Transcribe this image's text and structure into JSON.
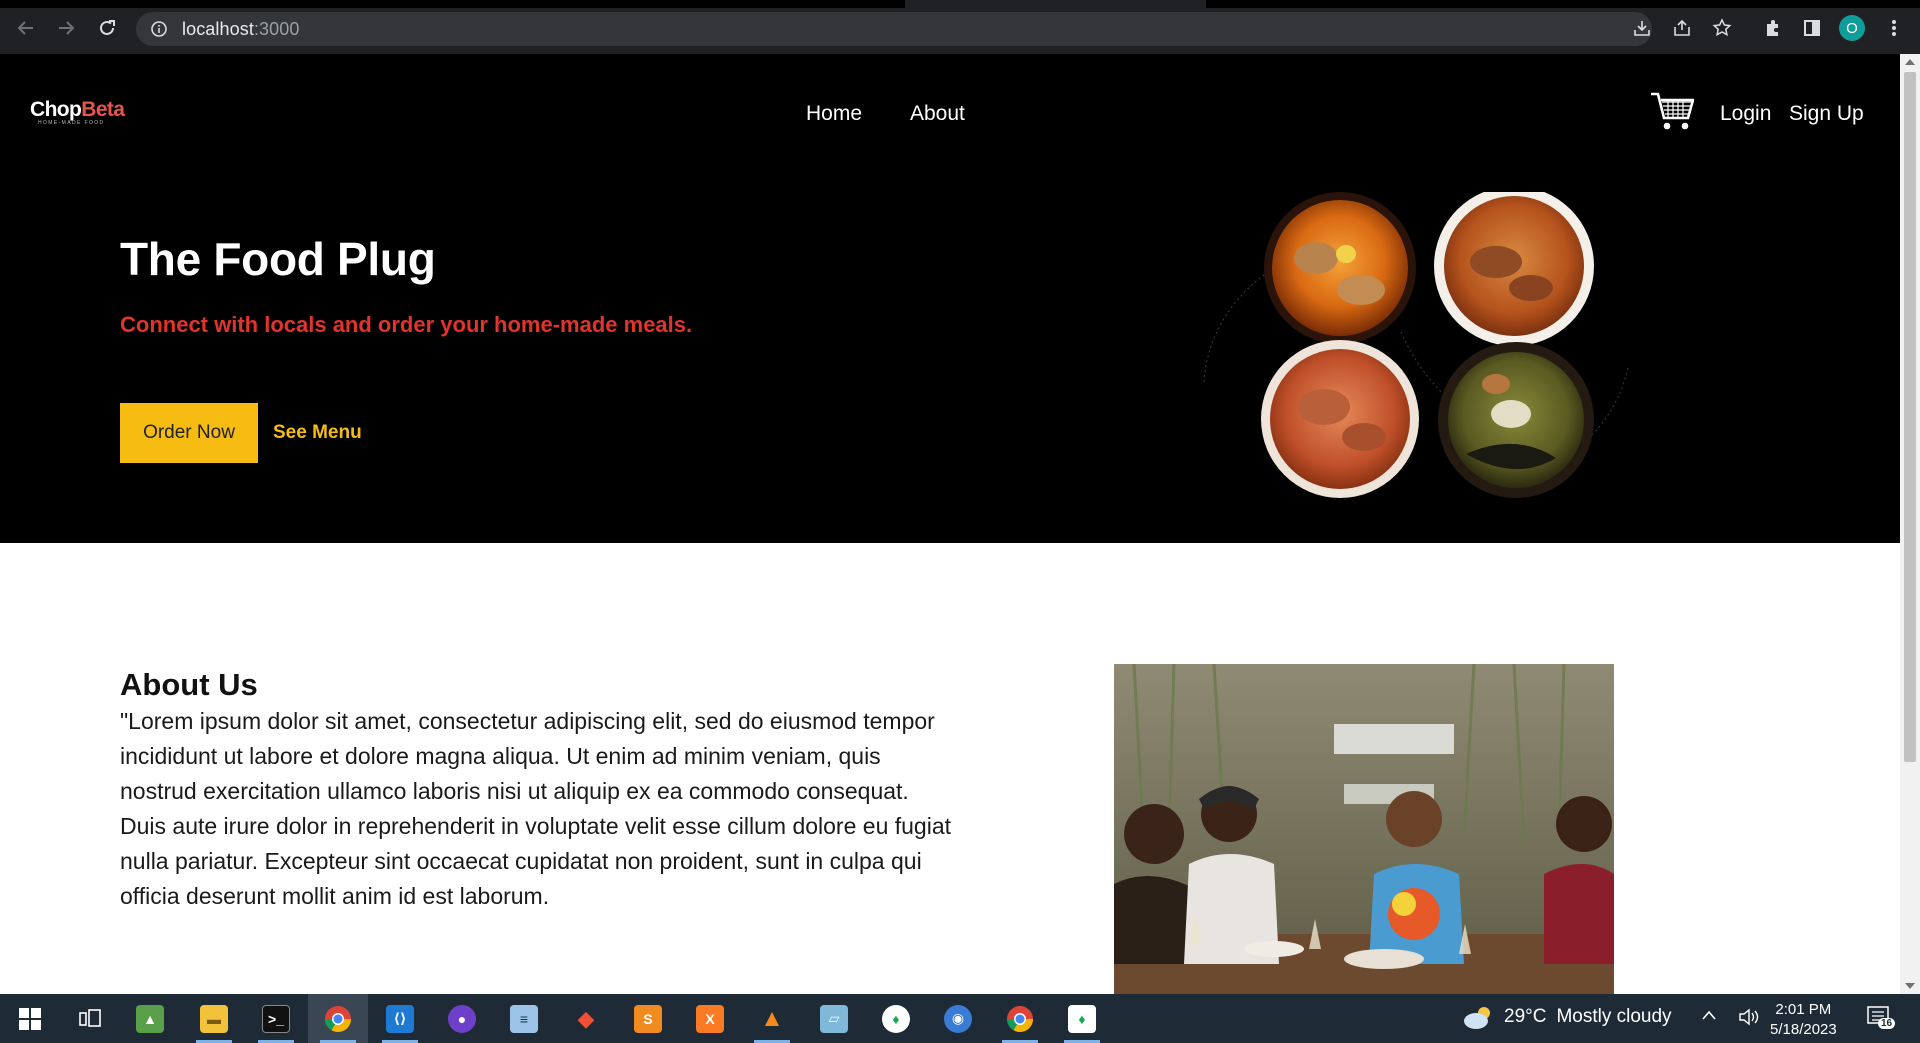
{
  "browser": {
    "url_host": "localhost",
    "url_port": ":3000",
    "profile_initial": "O",
    "icons": [
      "back-icon",
      "forward-icon",
      "reload-icon",
      "info-icon",
      "install-icon",
      "share-icon",
      "star-icon",
      "extensions-icon",
      "side-panel-icon",
      "menu-dots-icon"
    ]
  },
  "site": {
    "logo_main": "Chop",
    "logo_accent": "Beta",
    "logo_tagline": "HOME-MADE FOOD",
    "nav": {
      "home": "Home",
      "about": "About",
      "login": "Login",
      "signup": "Sign Up"
    },
    "hero": {
      "title": "The Food Plug",
      "subtitle": "Connect with locals and order your home-made meals.",
      "order_button": "Order Now",
      "menu_link": "See Menu"
    },
    "about": {
      "title": "About Us",
      "body": "\"Lorem ipsum dolor sit amet, consectetur adipiscing elit, sed do eiusmod tempor incididunt ut labore et dolore magna aliqua. Ut enim ad minim veniam, quis nostrud exercitation ullamco laboris nisi ut aliquip ex ea commodo consequat. Duis aute irure dolor in reprehenderit in voluptate velit esse cillum dolore eu fugiat nulla pariatur. Excepteur sint occaecat cupidatat non proident, sunt in culpa qui officia deserunt mollit anim id est laborum."
    },
    "colors": {
      "accent_yellow": "#f6bc12",
      "accent_red": "#e2332c",
      "hero_bg": "#000000"
    }
  },
  "taskbar": {
    "apps": [
      "windows-start",
      "task-view",
      "photo-app",
      "file-explorer",
      "terminal",
      "chrome",
      "vscode",
      "github-desktop",
      "notepad",
      "git",
      "sublime-text",
      "xampp",
      "vlc",
      "notes",
      "mongodb-compass",
      "edge-like",
      "chrome-dev",
      "mongodb"
    ],
    "weather_temp": "29°C",
    "weather_text": "Mostly cloudy",
    "time": "2:01 PM",
    "date": "5/18/2023",
    "notification_count": "16"
  }
}
